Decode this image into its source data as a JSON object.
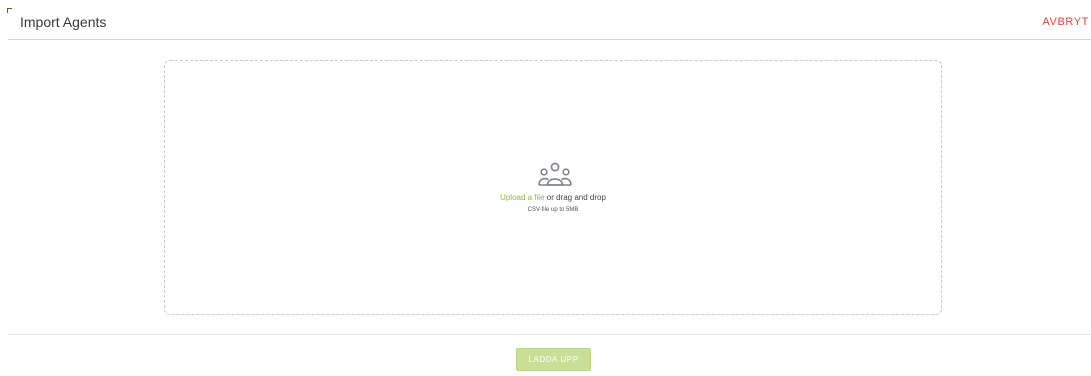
{
  "header": {
    "title": "Import Agents",
    "cancel_label": "AVBRYT"
  },
  "dropzone": {
    "icon": "users-icon",
    "upload_link_label": "Upload a file",
    "drag_text": " or drag and drop",
    "hint": "CSV-file up to 5MB"
  },
  "footer": {
    "upload_button_label": "LADDA UPP"
  },
  "colors": {
    "accent_green": "#8bbf2e",
    "button_green": "#c9df96",
    "cancel_red": "#e8403a"
  }
}
